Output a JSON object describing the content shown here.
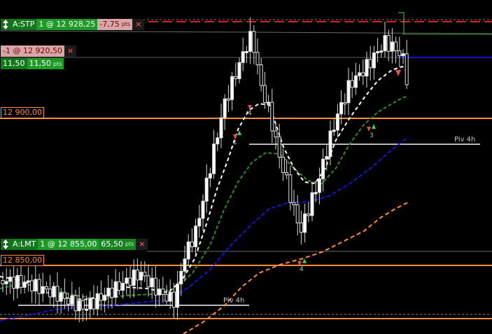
{
  "colors": {
    "background": "#000000",
    "price_level": "#ff8c3a",
    "stop_line": "#e01e1e",
    "blue_ma": "#0a12c8",
    "green_ma": "#2f8a2f",
    "orange_ma": "#ff8c3a",
    "white_ma": "#ffffff",
    "candle": "#e0e0e0"
  },
  "stop_order": {
    "label": "A:STP",
    "detail": "1 @ 12 928,25",
    "pnl": "-7,75",
    "unit": "pts",
    "close": "×"
  },
  "position": {
    "label": "-1 @ 12 920,50",
    "close": "×",
    "value1": "11,50",
    "value2": "11,50",
    "unit": "pts"
  },
  "limit_order": {
    "label": "A:LMT",
    "detail": "1 @ 12 855,00",
    "pnl": "65,50",
    "unit": "pts",
    "close": "×"
  },
  "levels": {
    "upper": "12 900,00",
    "lower": "12 850,00"
  },
  "pivots": {
    "upper": "Piv 4h",
    "lower": "Piv 4h"
  },
  "markers": [
    "4",
    "1",
    "3",
    "4"
  ]
}
